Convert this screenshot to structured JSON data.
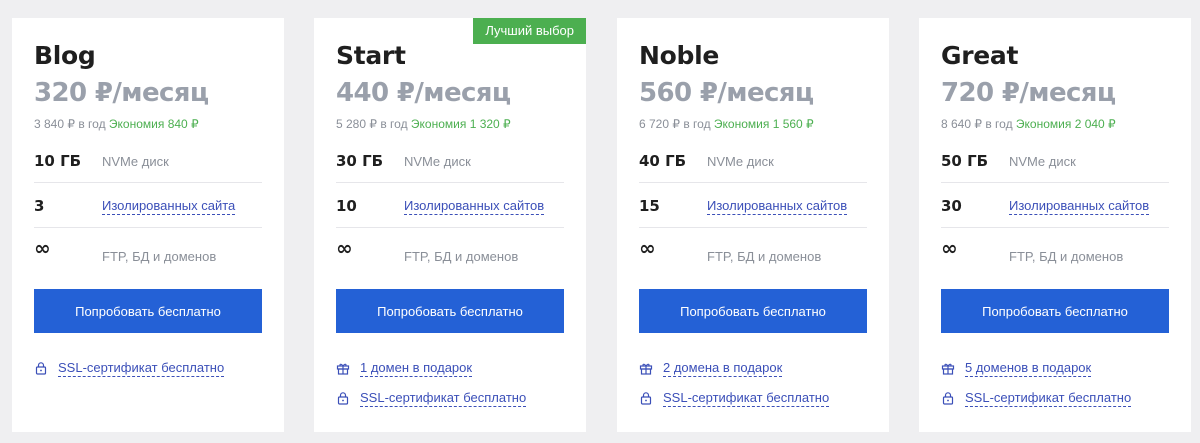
{
  "colors": {
    "accent": "#2461d6",
    "link": "#3b4fb8",
    "savings": "#4caf50",
    "badge": "#4caf50",
    "price": "#9aa0ab"
  },
  "plans": [
    {
      "name": "Blog",
      "price": "320 ₽/месяц",
      "yearly": "3 840 ₽ в год",
      "savings": "Экономия 840 ₽",
      "storage_value": "10 ГБ",
      "storage_label": "NVMe диск",
      "sites_value": "3",
      "sites_label": "Изолированных сайта",
      "ftp_value": "∞",
      "ftp_label": "FTP, БД и доменов",
      "cta": "Попробовать бесплатно",
      "bonuses": [
        {
          "icon": "lock-icon",
          "label": "SSL-сертификат бесплатно"
        }
      ]
    },
    {
      "name": "Start",
      "badge": "Лучший выбор",
      "price": "440 ₽/месяц",
      "yearly": "5 280 ₽ в год",
      "savings": "Экономия 1 320 ₽",
      "storage_value": "30 ГБ",
      "storage_label": "NVMe диск",
      "sites_value": "10",
      "sites_label": "Изолированных сайтов",
      "ftp_value": "∞",
      "ftp_label": "FTP, БД и доменов",
      "cta": "Попробовать бесплатно",
      "bonuses": [
        {
          "icon": "gift-icon",
          "label": "1 домен в подарок"
        },
        {
          "icon": "lock-icon",
          "label": "SSL-сертификат бесплатно"
        }
      ]
    },
    {
      "name": "Noble",
      "price": "560 ₽/месяц",
      "yearly": "6 720 ₽ в год",
      "savings": "Экономия 1 560 ₽",
      "storage_value": "40 ГБ",
      "storage_label": "NVMe диск",
      "sites_value": "15",
      "sites_label": "Изолированных сайтов",
      "ftp_value": "∞",
      "ftp_label": "FTP, БД и доменов",
      "cta": "Попробовать бесплатно",
      "bonuses": [
        {
          "icon": "gift-icon",
          "label": "2 домена в подарок"
        },
        {
          "icon": "lock-icon",
          "label": "SSL-сертификат бесплатно"
        }
      ]
    },
    {
      "name": "Great",
      "price": "720 ₽/месяц",
      "yearly": "8 640 ₽ в год",
      "savings": "Экономия 2 040 ₽",
      "storage_value": "50 ГБ",
      "storage_label": "NVMe диск",
      "sites_value": "30",
      "sites_label": "Изолированных сайтов",
      "ftp_value": "∞",
      "ftp_label": "FTP, БД и доменов",
      "cta": "Попробовать бесплатно",
      "bonuses": [
        {
          "icon": "gift-icon",
          "label": "5 доменов в подарок"
        },
        {
          "icon": "lock-icon",
          "label": "SSL-сертификат бесплатно"
        }
      ]
    }
  ]
}
